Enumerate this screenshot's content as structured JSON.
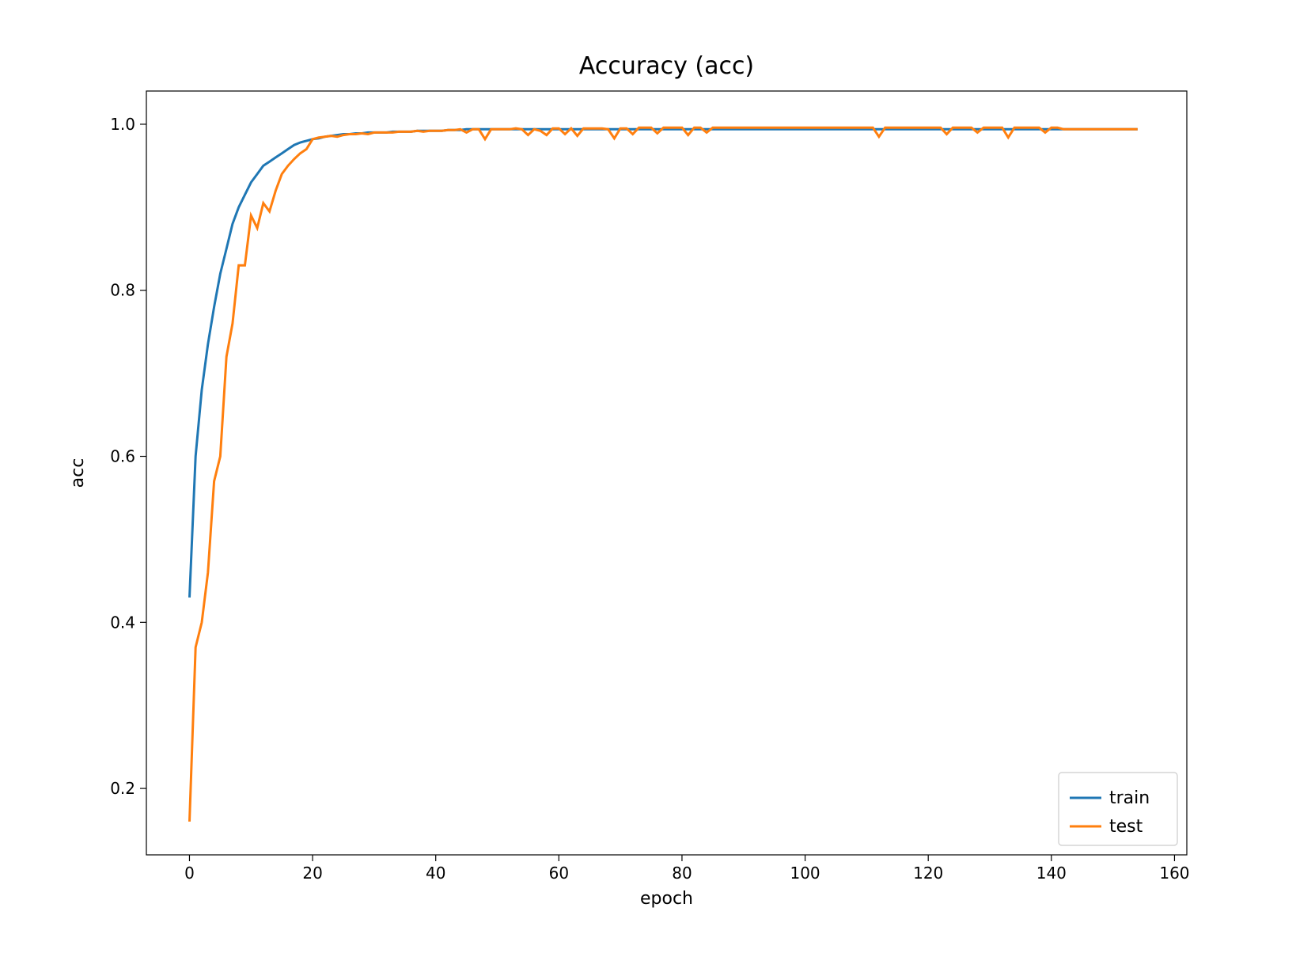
{
  "chart_data": {
    "type": "line",
    "title": "Accuracy (acc)",
    "xlabel": "epoch",
    "ylabel": "acc",
    "xlim": [
      -7,
      162
    ],
    "ylim": [
      0.12,
      1.04
    ],
    "xticks": [
      0,
      20,
      40,
      60,
      80,
      100,
      120,
      140,
      160
    ],
    "yticks": [
      0.2,
      0.4,
      0.6,
      0.8,
      1.0
    ],
    "legend_position": "lower right",
    "grid": false,
    "series": [
      {
        "name": "train",
        "color": "#1f77b4",
        "x": [
          0,
          1,
          2,
          3,
          4,
          5,
          6,
          7,
          8,
          9,
          10,
          11,
          12,
          13,
          14,
          15,
          16,
          17,
          18,
          19,
          20,
          21,
          22,
          23,
          24,
          25,
          26,
          27,
          28,
          29,
          30,
          31,
          32,
          33,
          34,
          35,
          36,
          37,
          38,
          39,
          40,
          41,
          42,
          43,
          44,
          45,
          46,
          47,
          48,
          49,
          50,
          51,
          52,
          53,
          54,
          55,
          56,
          57,
          58,
          59,
          60,
          61,
          62,
          63,
          64,
          65,
          66,
          67,
          68,
          69,
          70,
          71,
          72,
          73,
          74,
          75,
          76,
          77,
          78,
          79,
          80,
          81,
          82,
          83,
          84,
          85,
          86,
          87,
          88,
          89,
          90,
          91,
          92,
          93,
          94,
          95,
          96,
          97,
          98,
          99,
          100,
          101,
          102,
          103,
          104,
          105,
          106,
          107,
          108,
          109,
          110,
          111,
          112,
          113,
          114,
          115,
          116,
          117,
          118,
          119,
          120,
          121,
          122,
          123,
          124,
          125,
          126,
          127,
          128,
          129,
          130,
          131,
          132,
          133,
          134,
          135,
          136,
          137,
          138,
          139,
          140,
          141,
          142,
          143,
          144,
          145,
          146,
          147,
          148,
          149,
          150,
          151,
          152,
          153,
          154
        ],
        "values": [
          0.43,
          0.6,
          0.68,
          0.735,
          0.78,
          0.82,
          0.85,
          0.88,
          0.9,
          0.915,
          0.93,
          0.94,
          0.95,
          0.955,
          0.96,
          0.965,
          0.97,
          0.975,
          0.978,
          0.98,
          0.982,
          0.983,
          0.985,
          0.986,
          0.987,
          0.988,
          0.988,
          0.989,
          0.989,
          0.99,
          0.99,
          0.99,
          0.99,
          0.991,
          0.991,
          0.991,
          0.991,
          0.992,
          0.992,
          0.992,
          0.992,
          0.992,
          0.993,
          0.993,
          0.993,
          0.994,
          0.994,
          0.994,
          0.994,
          0.994,
          0.994,
          0.994,
          0.994,
          0.994,
          0.994,
          0.994,
          0.994,
          0.994,
          0.994,
          0.994,
          0.994,
          0.994,
          0.994,
          0.994,
          0.994,
          0.994,
          0.994,
          0.994,
          0.994,
          0.994,
          0.994,
          0.994,
          0.994,
          0.994,
          0.994,
          0.994,
          0.994,
          0.994,
          0.994,
          0.994,
          0.994,
          0.994,
          0.994,
          0.994,
          0.994,
          0.994,
          0.994,
          0.994,
          0.994,
          0.994,
          0.994,
          0.994,
          0.994,
          0.994,
          0.994,
          0.994,
          0.994,
          0.994,
          0.994,
          0.994,
          0.994,
          0.994,
          0.994,
          0.994,
          0.994,
          0.994,
          0.994,
          0.994,
          0.994,
          0.994,
          0.994,
          0.994,
          0.994,
          0.994,
          0.994,
          0.994,
          0.994,
          0.994,
          0.994,
          0.994,
          0.994,
          0.994,
          0.994,
          0.994,
          0.994,
          0.994,
          0.994,
          0.994,
          0.994,
          0.994,
          0.994,
          0.994,
          0.994,
          0.994,
          0.994,
          0.994,
          0.994,
          0.994,
          0.994,
          0.994,
          0.994,
          0.994,
          0.994,
          0.994,
          0.994,
          0.994,
          0.994,
          0.994,
          0.994,
          0.994,
          0.994,
          0.994,
          0.994,
          0.994,
          0.994
        ]
      },
      {
        "name": "test",
        "color": "#ff7f0e",
        "x": [
          0,
          1,
          2,
          3,
          4,
          5,
          6,
          7,
          8,
          9,
          10,
          11,
          12,
          13,
          14,
          15,
          16,
          17,
          18,
          19,
          20,
          21,
          22,
          23,
          24,
          25,
          26,
          27,
          28,
          29,
          30,
          31,
          32,
          33,
          34,
          35,
          36,
          37,
          38,
          39,
          40,
          41,
          42,
          43,
          44,
          45,
          46,
          47,
          48,
          49,
          50,
          51,
          52,
          53,
          54,
          55,
          56,
          57,
          58,
          59,
          60,
          61,
          62,
          63,
          64,
          65,
          66,
          67,
          68,
          69,
          70,
          71,
          72,
          73,
          74,
          75,
          76,
          77,
          78,
          79,
          80,
          81,
          82,
          83,
          84,
          85,
          86,
          87,
          88,
          89,
          90,
          91,
          92,
          93,
          94,
          95,
          96,
          97,
          98,
          99,
          100,
          101,
          102,
          103,
          104,
          105,
          106,
          107,
          108,
          109,
          110,
          111,
          112,
          113,
          114,
          115,
          116,
          117,
          118,
          119,
          120,
          121,
          122,
          123,
          124,
          125,
          126,
          127,
          128,
          129,
          130,
          131,
          132,
          133,
          134,
          135,
          136,
          137,
          138,
          139,
          140,
          141,
          142,
          143,
          144,
          145,
          146,
          147,
          148,
          149,
          150,
          151,
          152,
          153,
          154
        ],
        "values": [
          0.16,
          0.37,
          0.4,
          0.46,
          0.57,
          0.6,
          0.72,
          0.76,
          0.83,
          0.83,
          0.89,
          0.875,
          0.905,
          0.895,
          0.92,
          0.94,
          0.95,
          0.958,
          0.965,
          0.97,
          0.982,
          0.984,
          0.985,
          0.986,
          0.985,
          0.987,
          0.988,
          0.988,
          0.989,
          0.988,
          0.99,
          0.99,
          0.99,
          0.99,
          0.991,
          0.991,
          0.991,
          0.992,
          0.991,
          0.992,
          0.992,
          0.992,
          0.993,
          0.993,
          0.994,
          0.99,
          0.994,
          0.994,
          0.982,
          0.994,
          0.994,
          0.994,
          0.994,
          0.995,
          0.994,
          0.987,
          0.994,
          0.992,
          0.987,
          0.995,
          0.995,
          0.988,
          0.995,
          0.986,
          0.995,
          0.995,
          0.995,
          0.995,
          0.994,
          0.983,
          0.995,
          0.995,
          0.988,
          0.996,
          0.996,
          0.996,
          0.989,
          0.996,
          0.996,
          0.996,
          0.996,
          0.987,
          0.996,
          0.996,
          0.99,
          0.996,
          0.996,
          0.996,
          0.996,
          0.996,
          0.996,
          0.996,
          0.996,
          0.996,
          0.996,
          0.996,
          0.996,
          0.996,
          0.996,
          0.996,
          0.996,
          0.996,
          0.996,
          0.996,
          0.996,
          0.996,
          0.996,
          0.996,
          0.996,
          0.996,
          0.996,
          0.996,
          0.985,
          0.996,
          0.996,
          0.996,
          0.996,
          0.996,
          0.996,
          0.996,
          0.996,
          0.996,
          0.996,
          0.988,
          0.996,
          0.996,
          0.996,
          0.996,
          0.99,
          0.996,
          0.996,
          0.996,
          0.996,
          0.984,
          0.996,
          0.996,
          0.996,
          0.996,
          0.996,
          0.99,
          0.996,
          0.996,
          0.994,
          0.994,
          0.994,
          0.994,
          0.994,
          0.994,
          0.994,
          0.994,
          0.994,
          0.994,
          0.994,
          0.994,
          0.994
        ]
      }
    ]
  }
}
